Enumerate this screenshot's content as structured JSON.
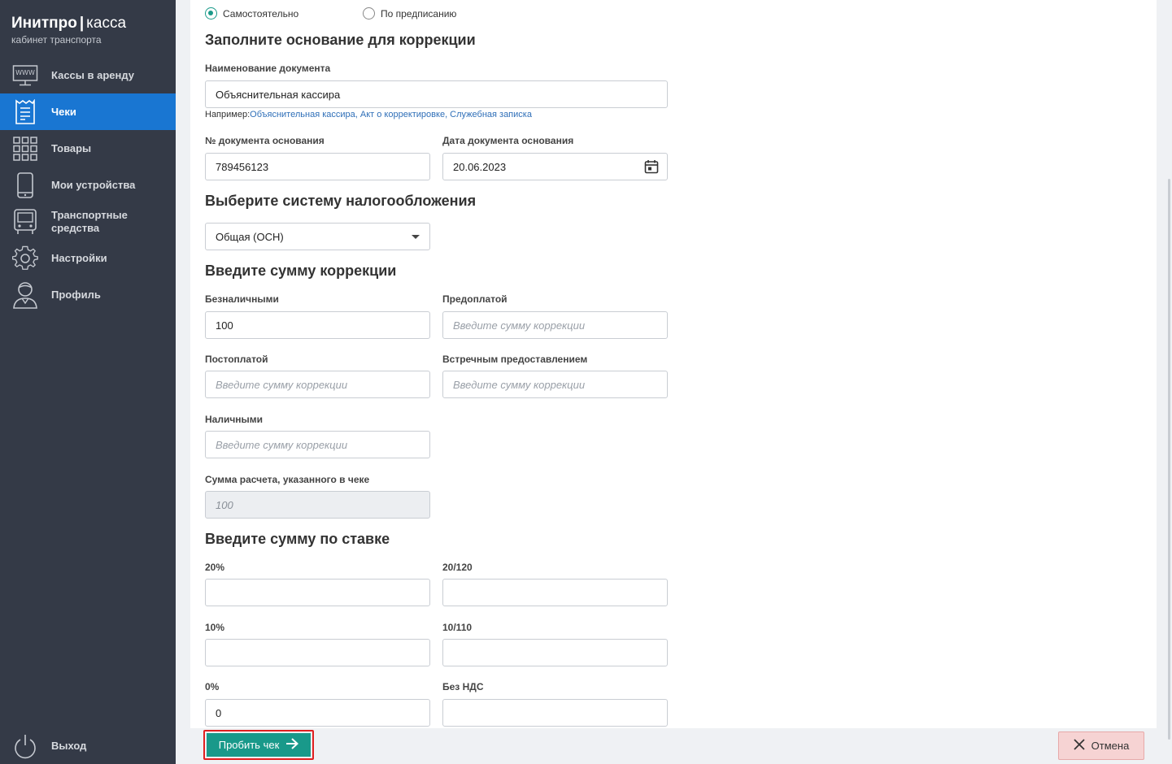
{
  "brand": {
    "name": "Инитпро",
    "product": "касса",
    "subtitle": "кабинет транспорта"
  },
  "sidebar": {
    "items": [
      {
        "label": "Кассы в аренду",
        "icon": "www-monitor-icon",
        "active": false
      },
      {
        "label": "Чеки",
        "icon": "receipt-icon",
        "active": true
      },
      {
        "label": "Товары",
        "icon": "grid-icon",
        "active": false
      },
      {
        "label": "Мои устройства",
        "icon": "phone-icon",
        "active": false
      },
      {
        "label": "Транспортные средства",
        "icon": "bus-icon",
        "active": false
      },
      {
        "label": "Настройки",
        "icon": "gear-icon",
        "active": false
      },
      {
        "label": "Профиль",
        "icon": "user-icon",
        "active": false
      }
    ],
    "logout": "Выход"
  },
  "mode": {
    "option1": "Самостоятельно",
    "option2": "По предписанию",
    "selected": "option1"
  },
  "basis": {
    "heading": "Заполните основание для коррекции",
    "doc_name_label": "Наименование документа",
    "doc_name_value": "Объяснительная кассира",
    "hint_prefix": "Например:",
    "hint_examples": "Объяснительная кассира, Акт о корректировке, Служебная записка",
    "doc_number_label": "№ документа основания",
    "doc_number_value": "789456123",
    "doc_date_label": "Дата документа основания",
    "doc_date_value": "20.06.2023"
  },
  "tax": {
    "heading": "Выберите систему налогообложения",
    "selected": "Общая (ОСН)"
  },
  "amounts": {
    "heading": "Введите сумму коррекции",
    "placeholder": "Введите сумму коррекции",
    "cashless_label": "Безналичными",
    "cashless_value": "100",
    "prepay_label": "Предоплатой",
    "postpay_label": "Постоплатой",
    "counter_label": "Встречным предоставлением",
    "cash_label": "Наличными",
    "total_label": "Сумма расчета, указанного в чеке",
    "total_value": "100"
  },
  "rates": {
    "heading": "Введите сумму по ставке",
    "r20": "20%",
    "r20_120": "20/120",
    "r10": "10%",
    "r10_110": "10/110",
    "r0": "0%",
    "r0_value": "0",
    "no_vat": "Без НДС"
  },
  "footer": {
    "submit": "Пробить чек",
    "cancel": "Отмена"
  },
  "colors": {
    "sidebar": "#343a47",
    "active": "#1976d2",
    "primary": "#19998a",
    "cancel_bg": "#f6d3d3",
    "highlight": "#e02020"
  }
}
